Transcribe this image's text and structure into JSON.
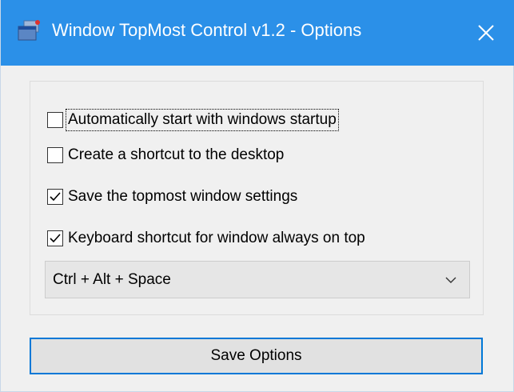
{
  "window": {
    "title": "Window TopMost Control v1.2 - Options",
    "app_icon": "window-stack-icon",
    "close_icon": "close-icon",
    "accent_color": "#2b90e8"
  },
  "options": {
    "autostart": {
      "label": "Automatically start with windows startup",
      "checked": false
    },
    "desktop_shortcut": {
      "label": "Create a shortcut to the desktop",
      "checked": false
    },
    "save_settings": {
      "label": "Save the topmost window settings",
      "checked": true
    },
    "keyboard_shortcut": {
      "label": "Keyboard shortcut for window always on top",
      "checked": true
    }
  },
  "hotkey": {
    "selected": "Ctrl + Alt + Space",
    "arrow_icon": "chevron-down-icon"
  },
  "actions": {
    "save_label": "Save Options"
  }
}
